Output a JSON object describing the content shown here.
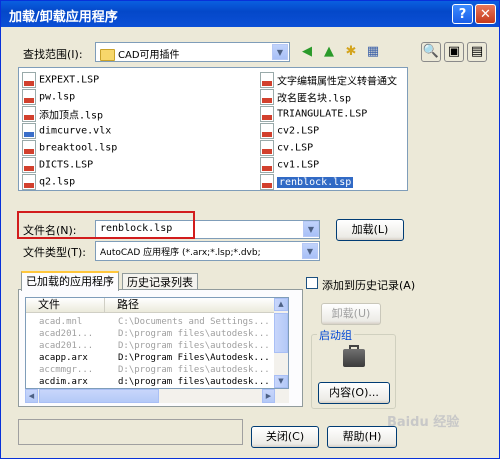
{
  "window": {
    "title": "加载/卸载应用程序",
    "help_btn": "?",
    "close_btn": "✕"
  },
  "lookin": {
    "label": "查找范围(I):",
    "value": "CAD可用插件"
  },
  "files_left": [
    "EXPEXT.LSP",
    "pw.lsp",
    "添加顶点.lsp",
    "dimcurve.vlx",
    "breaktool.lsp",
    "DICTS.LSP",
    "q2.lsp"
  ],
  "files_right": [
    "文字编辑属性定义转普通文",
    "改名匿名块.lsp",
    "TRIANGULATE.LSP",
    "cv2.LSP",
    "cv.LSP",
    "cv1.LSP",
    "renblock.lsp"
  ],
  "filename": {
    "label": "文件名(N):",
    "value": "renblock.lsp",
    "load_btn": "加载(L)"
  },
  "filetype": {
    "label": "文件类型(T):",
    "value": "AutoCAD 应用程序 (*.arx;*.lsp;*.dvb;"
  },
  "tabs": [
    "已加载的应用程序",
    "历史记录列表"
  ],
  "loaded": {
    "col_file": "文件",
    "col_path": "路径",
    "rows": [
      {
        "file": "acad.mnl",
        "path": "C:\\Documents and Settings..."
      },
      {
        "file": "acad201...",
        "path": "D:\\program files\\autodesk..."
      },
      {
        "file": "acad201...",
        "path": "D:\\program files\\autodesk..."
      },
      {
        "file": "acapp.arx",
        "path": "D:\\Program Files\\Autodesk..."
      },
      {
        "file": "accmmgr...",
        "path": "D:\\program files\\autodesk..."
      },
      {
        "file": "acdim.arx",
        "path": "d:\\program files\\autodesk..."
      }
    ]
  },
  "add_history": "添加到历史记录(A)",
  "unload_btn": "卸载(U)",
  "startup": {
    "label": "启动组",
    "contents_btn": "内容(O)..."
  },
  "close_btn": "关闭(C)",
  "help_btn": "帮助(H)",
  "watermark": "Baidu 经验"
}
